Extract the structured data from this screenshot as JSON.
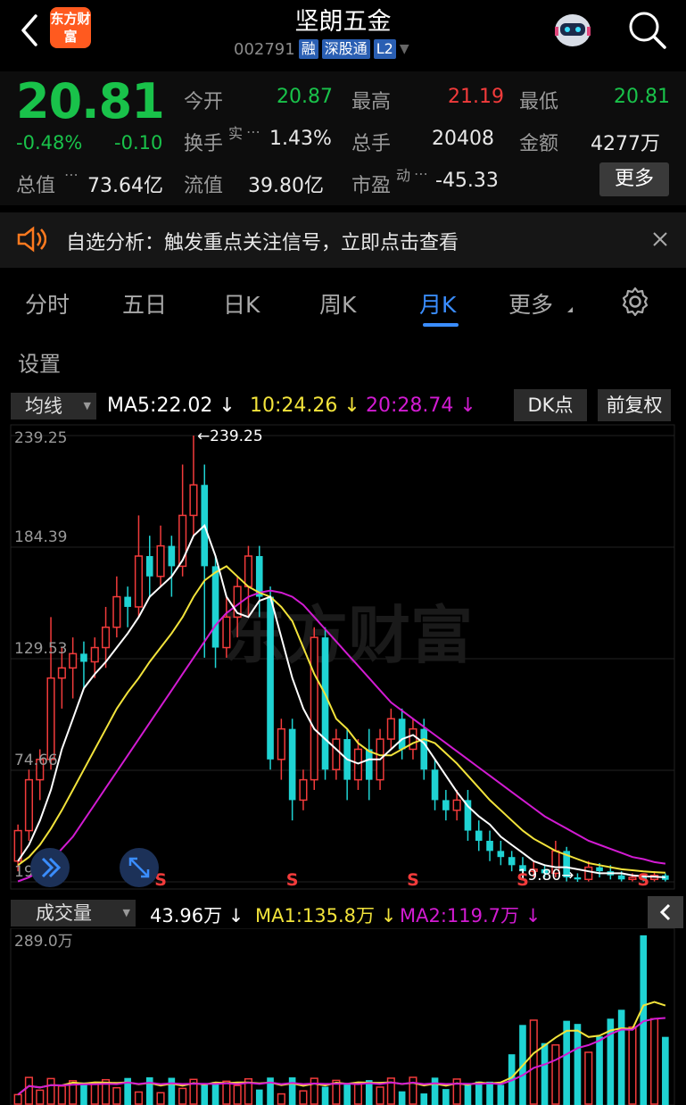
{
  "header": {
    "title": "坚朗五金",
    "code": "002791",
    "tags": [
      "融",
      "深股通",
      "L2"
    ],
    "logo_text": "东方财富"
  },
  "quote": {
    "price": "20.81",
    "change_pct": "-0.48%",
    "change": "-0.10",
    "open_label": "今开",
    "open": "20.87",
    "high_label": "最高",
    "high": "21.19",
    "low_label": "最低",
    "low": "20.81",
    "turnover_label": "换手",
    "turnover_sup": "实",
    "turnover": "1.43%",
    "volume_label": "总手",
    "volume": "20408",
    "amount_label": "金额",
    "amount": "4277万",
    "mcap_label": "总值",
    "mcap": "73.64亿",
    "float_label": "流值",
    "float": "39.80亿",
    "pe_label": "市盈",
    "pe_sup": "动",
    "pe": "-45.33",
    "more_label": "更多"
  },
  "notice": {
    "text": "自选分析：触发重点关注信号，立即点击查看"
  },
  "tabs": [
    "分时",
    "五日",
    "日K",
    "周K",
    "月K",
    "更多"
  ],
  "active_tab": "月K",
  "settings_label": "设置",
  "chart_toolbar": {
    "ma_button": "均线",
    "ma5": "MA5:22.02 ↓",
    "ma10": "10:24.26 ↓",
    "ma20": "20:28.74 ↓",
    "dk_button": "DK点",
    "adjust_button": "前复权"
  },
  "volume_toolbar": {
    "button": "成交量",
    "current": "43.96万 ↓",
    "ma1": "MA1:135.8万 ↓",
    "ma2": "MA2:119.7万 ↓"
  },
  "colors": {
    "up": "#f23b3b",
    "down": "#1fd3d3",
    "ma5": "#ffffff",
    "ma10": "#f2e33b",
    "ma20": "#d21bd2",
    "accent": "#3a8dff"
  },
  "chart_data": {
    "type": "candlestick",
    "price_axis_labels": [
      "239.25",
      "184.39",
      "129.53",
      "74.66",
      "19.80"
    ],
    "ylim": [
      19.8,
      239.25
    ],
    "high_marker": "239.25",
    "low_marker": "19.80",
    "signals": [
      "S",
      "S",
      "S",
      "S",
      "S"
    ],
    "watermark": "东方财富",
    "volume_axis_label": "289.0万",
    "candles": [
      [
        30,
        45,
        25,
        48
      ],
      [
        45,
        70,
        40,
        75
      ],
      [
        70,
        80,
        60,
        85
      ],
      [
        80,
        120,
        75,
        150
      ],
      [
        120,
        125,
        105,
        135
      ],
      [
        125,
        132,
        110,
        140
      ],
      [
        132,
        128,
        115,
        138
      ],
      [
        128,
        135,
        120,
        140
      ],
      [
        135,
        145,
        125,
        155
      ],
      [
        145,
        160,
        140,
        170
      ],
      [
        160,
        155,
        145,
        165
      ],
      [
        155,
        180,
        150,
        200
      ],
      [
        180,
        170,
        160,
        190
      ],
      [
        170,
        185,
        165,
        195
      ],
      [
        185,
        175,
        160,
        190
      ],
      [
        175,
        200,
        170,
        225
      ],
      [
        200,
        215,
        190,
        239.25
      ],
      [
        215,
        175,
        130,
        225
      ],
      [
        175,
        135,
        125,
        180
      ],
      [
        135,
        150,
        130,
        160
      ],
      [
        150,
        165,
        140,
        170
      ],
      [
        165,
        180,
        150,
        185
      ],
      [
        180,
        160,
        150,
        185
      ],
      [
        160,
        80,
        75,
        165
      ],
      [
        80,
        95,
        70,
        100
      ],
      [
        95,
        60,
        50,
        100
      ],
      [
        60,
        70,
        55,
        75
      ],
      [
        70,
        140,
        65,
        145
      ],
      [
        140,
        75,
        70,
        145
      ],
      [
        75,
        90,
        70,
        95
      ],
      [
        90,
        70,
        60,
        95
      ],
      [
        70,
        85,
        65,
        90
      ],
      [
        85,
        70,
        60,
        95
      ],
      [
        70,
        90,
        65,
        95
      ],
      [
        90,
        100,
        85,
        105
      ],
      [
        100,
        85,
        80,
        105
      ],
      [
        85,
        95,
        80,
        100
      ],
      [
        95,
        75,
        70,
        100
      ],
      [
        75,
        60,
        55,
        80
      ],
      [
        60,
        55,
        50,
        65
      ],
      [
        55,
        60,
        50,
        65
      ],
      [
        60,
        45,
        40,
        65
      ],
      [
        45,
        40,
        35,
        50
      ],
      [
        40,
        35,
        30,
        45
      ],
      [
        35,
        32,
        28,
        40
      ],
      [
        32,
        28,
        25,
        35
      ],
      [
        28,
        25,
        22,
        32
      ],
      [
        25,
        26,
        22,
        30
      ],
      [
        26,
        24,
        22,
        28
      ],
      [
        24,
        35,
        22,
        40
      ],
      [
        35,
        22,
        20,
        37
      ],
      [
        22,
        21,
        19.8,
        24
      ],
      [
        21,
        27,
        20,
        30
      ],
      [
        27,
        25,
        22,
        29
      ],
      [
        25,
        23,
        21,
        28
      ],
      [
        23,
        21,
        20,
        25
      ],
      [
        21,
        22,
        20,
        24
      ],
      [
        22,
        21,
        20,
        23
      ],
      [
        21,
        23,
        20,
        25
      ],
      [
        23,
        20.81,
        20,
        24
      ]
    ],
    "ma5": [
      30,
      38,
      50,
      65,
      85,
      100,
      115,
      122,
      128,
      135,
      142,
      150,
      160,
      165,
      170,
      178,
      190,
      195,
      180,
      160,
      152,
      150,
      158,
      160,
      140,
      120,
      105,
      95,
      90,
      85,
      80,
      78,
      80,
      80,
      85,
      90,
      92,
      88,
      80,
      72,
      64,
      57,
      52,
      48,
      42,
      38,
      34,
      30,
      28,
      27,
      27,
      26,
      25,
      24,
      24,
      24,
      23,
      22.5,
      22.3,
      22.02
    ],
    "ma10": [
      28,
      32,
      38,
      46,
      55,
      65,
      75,
      85,
      95,
      105,
      113,
      120,
      128,
      135,
      142,
      150,
      160,
      168,
      172,
      175,
      170,
      165,
      162,
      160,
      155,
      148,
      135,
      122,
      112,
      100,
      95,
      88,
      84,
      82,
      82,
      85,
      88,
      90,
      88,
      83,
      78,
      72,
      66,
      60,
      55,
      50,
      45,
      41,
      38,
      35,
      33,
      31,
      29,
      28,
      27,
      26,
      25.5,
      25,
      24.6,
      24.26
    ],
    "ma20": [
      20,
      22,
      25,
      30,
      36,
      42,
      50,
      58,
      66,
      74,
      82,
      90,
      98,
      106,
      114,
      122,
      130,
      138,
      146,
      152,
      156,
      160,
      162,
      163,
      162,
      160,
      156,
      150,
      144,
      138,
      132,
      126,
      120,
      114,
      108,
      104,
      100,
      96,
      92,
      88,
      84,
      80,
      76,
      72,
      68,
      64,
      60,
      56,
      52,
      49,
      46,
      43,
      40,
      38,
      36,
      34,
      32,
      31,
      29.5,
      28.74
    ]
  }
}
